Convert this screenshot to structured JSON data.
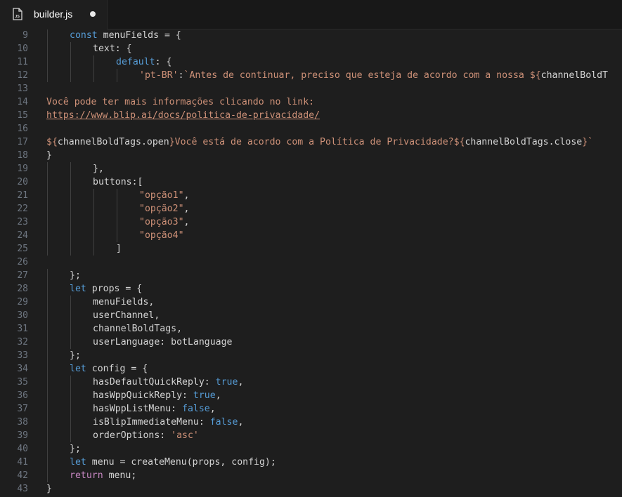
{
  "tab": {
    "filename": "builder.js",
    "icon": "js-file-icon",
    "modified": true
  },
  "editor": {
    "lines": [
      {
        "num": "9",
        "indent": 1,
        "tokens": [
          {
            "t": "kw",
            "v": "const"
          },
          {
            "t": "plain",
            "v": " menuFields = {"
          }
        ]
      },
      {
        "num": "10",
        "indent": 2,
        "tokens": [
          {
            "t": "plain",
            "v": "text: {"
          }
        ]
      },
      {
        "num": "11",
        "indent": 3,
        "tokens": [
          {
            "t": "kw",
            "v": "default"
          },
          {
            "t": "plain",
            "v": ": {"
          }
        ]
      },
      {
        "num": "12",
        "indent": 4,
        "tokens": [
          {
            "t": "str",
            "v": "'pt-BR'"
          },
          {
            "t": "plain",
            "v": ":"
          },
          {
            "t": "str",
            "v": "`Antes de continuar, preciso que esteja de acordo com a nossa ${"
          },
          {
            "t": "plain",
            "v": "channelBoldT"
          }
        ]
      },
      {
        "num": "13",
        "indent": 0,
        "tokens": []
      },
      {
        "num": "14",
        "indent": 0,
        "tokens": [
          {
            "t": "str",
            "v": "Você pode ter mais informações clicando no link:"
          }
        ]
      },
      {
        "num": "15",
        "indent": 0,
        "tokens": [
          {
            "t": "url",
            "v": "https://www.blip.ai/docs/politica-de-privacidade/"
          }
        ]
      },
      {
        "num": "16",
        "indent": 0,
        "tokens": []
      },
      {
        "num": "17",
        "indent": 0,
        "tokens": [
          {
            "t": "str",
            "v": "${"
          },
          {
            "t": "plain",
            "v": "channelBoldTags.open"
          },
          {
            "t": "str",
            "v": "}Você está de acordo com a Política de Privacidade?${"
          },
          {
            "t": "plain",
            "v": "channelBoldTags.close"
          },
          {
            "t": "str",
            "v": "}`"
          }
        ]
      },
      {
        "num": "18",
        "indent": 0,
        "tokens": [
          {
            "t": "plain",
            "v": "}"
          }
        ]
      },
      {
        "num": "19",
        "indent": 2,
        "tokens": [
          {
            "t": "plain",
            "v": "},"
          }
        ]
      },
      {
        "num": "20",
        "indent": 2,
        "tokens": [
          {
            "t": "plain",
            "v": "buttons:["
          }
        ]
      },
      {
        "num": "21",
        "indent": 4,
        "tokens": [
          {
            "t": "str",
            "v": "\"opção1\""
          },
          {
            "t": "plain",
            "v": ","
          }
        ]
      },
      {
        "num": "22",
        "indent": 4,
        "tokens": [
          {
            "t": "str",
            "v": "\"opção2\""
          },
          {
            "t": "plain",
            "v": ","
          }
        ]
      },
      {
        "num": "23",
        "indent": 4,
        "tokens": [
          {
            "t": "str",
            "v": "\"opção3\""
          },
          {
            "t": "plain",
            "v": ","
          }
        ]
      },
      {
        "num": "24",
        "indent": 4,
        "tokens": [
          {
            "t": "str",
            "v": "\"opção4\""
          }
        ]
      },
      {
        "num": "25",
        "indent": 3,
        "tokens": [
          {
            "t": "plain",
            "v": "]"
          }
        ]
      },
      {
        "num": "26",
        "indent": 0,
        "tokens": []
      },
      {
        "num": "27",
        "indent": 1,
        "tokens": [
          {
            "t": "plain",
            "v": "};"
          }
        ]
      },
      {
        "num": "28",
        "indent": 1,
        "tokens": [
          {
            "t": "kw",
            "v": "let"
          },
          {
            "t": "plain",
            "v": " props = {"
          }
        ]
      },
      {
        "num": "29",
        "indent": 2,
        "tokens": [
          {
            "t": "plain",
            "v": "menuFields,"
          }
        ]
      },
      {
        "num": "30",
        "indent": 2,
        "tokens": [
          {
            "t": "plain",
            "v": "userChannel,"
          }
        ]
      },
      {
        "num": "31",
        "indent": 2,
        "tokens": [
          {
            "t": "plain",
            "v": "channelBoldTags,"
          }
        ]
      },
      {
        "num": "32",
        "indent": 2,
        "tokens": [
          {
            "t": "plain",
            "v": "userLanguage: botLanguage"
          }
        ]
      },
      {
        "num": "33",
        "indent": 1,
        "tokens": [
          {
            "t": "plain",
            "v": "};"
          }
        ]
      },
      {
        "num": "34",
        "indent": 1,
        "tokens": [
          {
            "t": "kw",
            "v": "let"
          },
          {
            "t": "plain",
            "v": " config = {"
          }
        ]
      },
      {
        "num": "35",
        "indent": 2,
        "tokens": [
          {
            "t": "plain",
            "v": "hasDefaultQuickReply: "
          },
          {
            "t": "kw",
            "v": "true"
          },
          {
            "t": "plain",
            "v": ","
          }
        ]
      },
      {
        "num": "36",
        "indent": 2,
        "tokens": [
          {
            "t": "plain",
            "v": "hasWppQuickReply: "
          },
          {
            "t": "kw",
            "v": "true"
          },
          {
            "t": "plain",
            "v": ","
          }
        ]
      },
      {
        "num": "37",
        "indent": 2,
        "tokens": [
          {
            "t": "plain",
            "v": "hasWppListMenu: "
          },
          {
            "t": "kw",
            "v": "false"
          },
          {
            "t": "plain",
            "v": ","
          }
        ]
      },
      {
        "num": "38",
        "indent": 2,
        "tokens": [
          {
            "t": "plain",
            "v": "isBlipImmediateMenu: "
          },
          {
            "t": "kw",
            "v": "false"
          },
          {
            "t": "plain",
            "v": ","
          }
        ]
      },
      {
        "num": "39",
        "indent": 2,
        "tokens": [
          {
            "t": "plain",
            "v": "orderOptions: "
          },
          {
            "t": "str",
            "v": "'asc'"
          }
        ]
      },
      {
        "num": "40",
        "indent": 1,
        "tokens": [
          {
            "t": "plain",
            "v": "};"
          }
        ]
      },
      {
        "num": "41",
        "indent": 1,
        "tokens": [
          {
            "t": "kw",
            "v": "let"
          },
          {
            "t": "plain",
            "v": " menu = createMenu(props, config);"
          }
        ]
      },
      {
        "num": "42",
        "indent": 1,
        "tokens": [
          {
            "t": "ctl",
            "v": "return"
          },
          {
            "t": "plain",
            "v": " menu;"
          }
        ]
      },
      {
        "num": "43",
        "indent": 0,
        "tokens": [
          {
            "t": "plain",
            "v": "}"
          }
        ]
      }
    ]
  },
  "colors": {
    "background": "#1e1e1e",
    "keyword": "#569cd6",
    "string": "#ce9178",
    "plain": "#d4d4d4",
    "line_number": "#6e7681"
  }
}
